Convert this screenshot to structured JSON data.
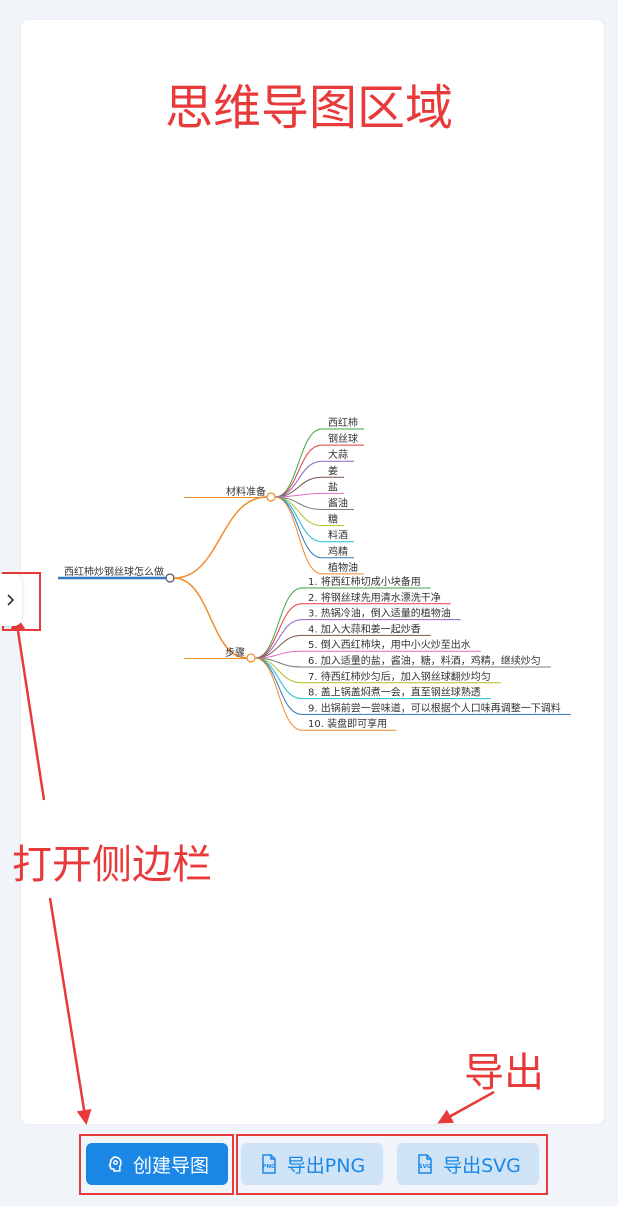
{
  "annotations": {
    "title": "思维导图区域",
    "sidebar": "打开侧边栏",
    "export": "导出"
  },
  "mindmap": {
    "root": "西红柿炒钢丝球怎么做",
    "branches": [
      {
        "label": "材料准备",
        "color": "#f08c2a",
        "children": [
          {
            "label": "西红柿",
            "color": "#3aa545"
          },
          {
            "label": "钢丝球",
            "color": "#e33b3b"
          },
          {
            "label": "大蒜",
            "color": "#8b62c7"
          },
          {
            "label": "姜",
            "color": "#7c5347"
          },
          {
            "label": "盐",
            "color": "#e26fc5"
          },
          {
            "label": "酱油",
            "color": "#7b7b7b"
          },
          {
            "label": "糖",
            "color": "#b7bd23"
          },
          {
            "label": "料酒",
            "color": "#20bccb"
          },
          {
            "label": "鸡精",
            "color": "#2f7ac2"
          },
          {
            "label": "植物油",
            "color": "#f08c2a"
          }
        ]
      },
      {
        "label": "步骤",
        "color": "#f08c2a",
        "children": [
          {
            "label": "1. 将西红柿切成小块备用",
            "color": "#3aa545"
          },
          {
            "label": "2. 将钢丝球先用清水漂洗干净",
            "color": "#e33b3b"
          },
          {
            "label": "3. 热锅冷油，倒入适量的植物油",
            "color": "#8b62c7"
          },
          {
            "label": "4. 加入大蒜和姜一起炒香",
            "color": "#7c5347"
          },
          {
            "label": "5. 倒入西红柿块，用中小火炒至出水",
            "color": "#e26fc5"
          },
          {
            "label": "6. 加入适量的盐，酱油，糖，料酒，鸡精，继续炒匀",
            "color": "#7b7b7b"
          },
          {
            "label": "7. 待西红柿炒匀后，加入钢丝球翻炒均匀",
            "color": "#b7bd23"
          },
          {
            "label": "8. 盖上锅盖焖煮一会，直至钢丝球熟透",
            "color": "#20bccb"
          },
          {
            "label": "9. 出锅前尝一尝味道，可以根据个人口味再调整一下调料",
            "color": "#2f7ac2"
          },
          {
            "label": "10. 装盘即可享用",
            "color": "#f08c2a"
          }
        ]
      }
    ]
  },
  "colors": {
    "annotation": "#e83a3a",
    "root_line": "#2f7ac2",
    "primary": "#1a87e6",
    "secondary_bg": "#cfe3f6"
  },
  "buttons": {
    "create": "创建导图",
    "export_png": "导出PNG",
    "export_svg": "导出SVG"
  },
  "icons": {
    "create": "brain-head-icon",
    "png": "png-file-icon",
    "svg": "svg-file-icon",
    "toggle": "chevron-right-icon"
  }
}
